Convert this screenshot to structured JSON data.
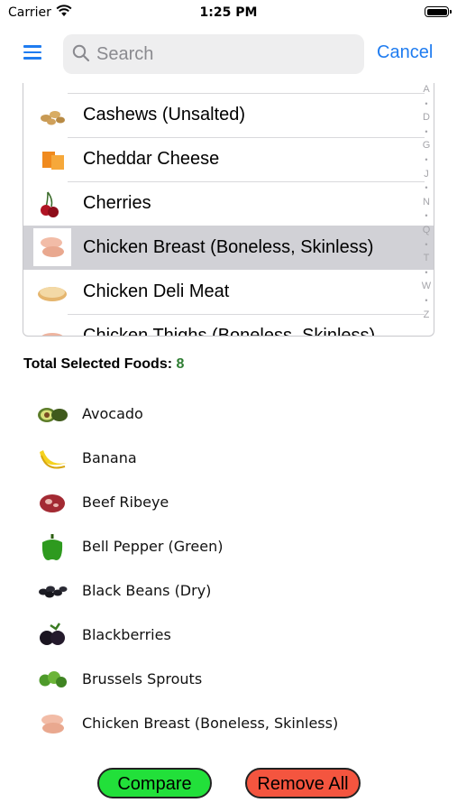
{
  "status_bar": {
    "carrier": "Carrier",
    "time": "1:25 PM"
  },
  "header": {
    "search_placeholder": "Search",
    "cancel_label": "Cancel"
  },
  "food_list": {
    "rows": [
      {
        "name": "Cashews (Unsalted)",
        "icon": "cashews-icon",
        "selected": false
      },
      {
        "name": "Cheddar Cheese",
        "icon": "cheese-icon",
        "selected": false
      },
      {
        "name": "Cherries",
        "icon": "cherries-icon",
        "selected": false
      },
      {
        "name": "Chicken Breast (Boneless, Skinless)",
        "icon": "chicken-breast-icon",
        "selected": true
      },
      {
        "name": "Chicken Deli Meat",
        "icon": "deli-meat-icon",
        "selected": false
      },
      {
        "name": "Chicken Thighs (Boneless, Skinless)",
        "icon": "chicken-thighs-icon",
        "selected": false
      }
    ],
    "index_letters": [
      "A",
      "•",
      "D",
      "•",
      "G",
      "•",
      "J",
      "•",
      "N",
      "•",
      "Q",
      "•",
      "T",
      "•",
      "W",
      "•",
      "Z"
    ]
  },
  "selected": {
    "label": "Total Selected Foods:",
    "count": "8",
    "items": [
      {
        "name": "Avocado",
        "icon": "avocado-icon"
      },
      {
        "name": "Banana",
        "icon": "banana-icon"
      },
      {
        "name": "Beef Ribeye",
        "icon": "beef-icon"
      },
      {
        "name": "Bell Pepper (Green)",
        "icon": "bell-pepper-icon"
      },
      {
        "name": "Black Beans (Dry)",
        "icon": "black-beans-icon"
      },
      {
        "name": "Blackberries",
        "icon": "blackberries-icon"
      },
      {
        "name": "Brussels Sprouts",
        "icon": "brussels-sprouts-icon"
      },
      {
        "name": "Chicken Breast (Boneless, Skinless)",
        "icon": "chicken-breast-icon"
      }
    ]
  },
  "actions": {
    "compare_label": "Compare",
    "remove_all_label": "Remove All"
  },
  "colors": {
    "accent": "#1f7cf0",
    "compare": "#22e03a",
    "remove": "#f4553f",
    "count": "#2e7d32",
    "row_selected": "#d1d1d6"
  }
}
